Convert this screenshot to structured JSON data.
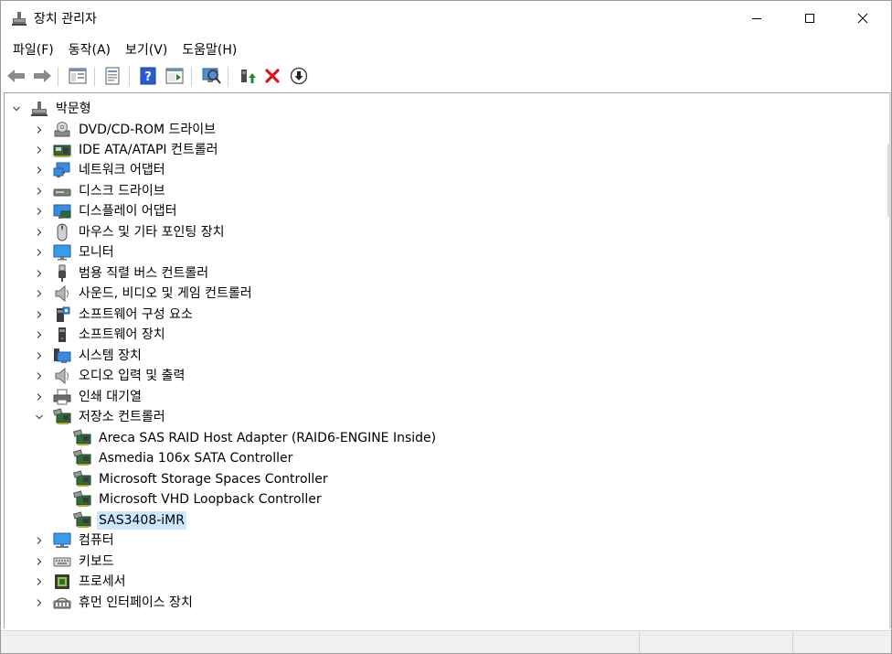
{
  "window": {
    "title": "장치 관리자",
    "icon": "device-manager-icon"
  },
  "menu": [
    {
      "label": "파일(F)"
    },
    {
      "label": "동작(A)"
    },
    {
      "label": "보기(V)"
    },
    {
      "label": "도움말(H)"
    }
  ],
  "toolbar": [
    "back-arrow-icon",
    "forward-arrow-icon",
    "show-hide-console-tree-icon",
    "properties-icon",
    "help-icon",
    "action-pane-icon",
    "scan-hardware-icon",
    "update-driver-icon",
    "uninstall-device-icon",
    "disable-device-icon"
  ],
  "tree": {
    "root": "박문형",
    "categories": [
      {
        "label": "DVD/CD-ROM 드라이브",
        "icon": "dvd-drive-icon"
      },
      {
        "label": "IDE ATA/ATAPI 컨트롤러",
        "icon": "ide-controller-icon"
      },
      {
        "label": "네트워크 어댑터",
        "icon": "network-adapter-icon"
      },
      {
        "label": "디스크 드라이브",
        "icon": "disk-drive-icon"
      },
      {
        "label": "디스플레이 어댑터",
        "icon": "display-adapter-icon"
      },
      {
        "label": "마우스 및 기타 포인팅 장치",
        "icon": "mouse-icon"
      },
      {
        "label": "모니터",
        "icon": "monitor-icon"
      },
      {
        "label": "범용 직렬 버스 컨트롤러",
        "icon": "usb-icon"
      },
      {
        "label": "사운드, 비디오 및 게임 컨트롤러",
        "icon": "speaker-icon"
      },
      {
        "label": "소프트웨어 구성 요소",
        "icon": "software-component-icon"
      },
      {
        "label": "소프트웨어 장치",
        "icon": "software-device-icon"
      },
      {
        "label": "시스템 장치",
        "icon": "system-device-icon"
      },
      {
        "label": "오디오 입력 및 출력",
        "icon": "speaker-icon"
      },
      {
        "label": "인쇄 대기열",
        "icon": "printer-icon"
      },
      {
        "label": "저장소 컨트롤러",
        "icon": "storage-controller-icon",
        "expanded": true,
        "children": [
          {
            "label": "Areca SAS RAID Host Adapter (RAID6-ENGINE Inside)"
          },
          {
            "label": "Asmedia 106x SATA Controller"
          },
          {
            "label": "Microsoft Storage Spaces Controller"
          },
          {
            "label": "Microsoft VHD Loopback Controller"
          },
          {
            "label": "SAS3408-iMR",
            "selected": true
          }
        ]
      },
      {
        "label": "컴퓨터",
        "icon": "computer-icon"
      },
      {
        "label": "키보드",
        "icon": "keyboard-icon"
      },
      {
        "label": "프로세서",
        "icon": "processor-icon"
      },
      {
        "label": "휴먼 인터페이스 장치",
        "icon": "hid-icon"
      }
    ]
  },
  "colors": {
    "selection": "#cce8ff",
    "accent_green": "#1e8a2e",
    "delete_red": "#d9141c",
    "help_blue": "#2a5bd7"
  }
}
